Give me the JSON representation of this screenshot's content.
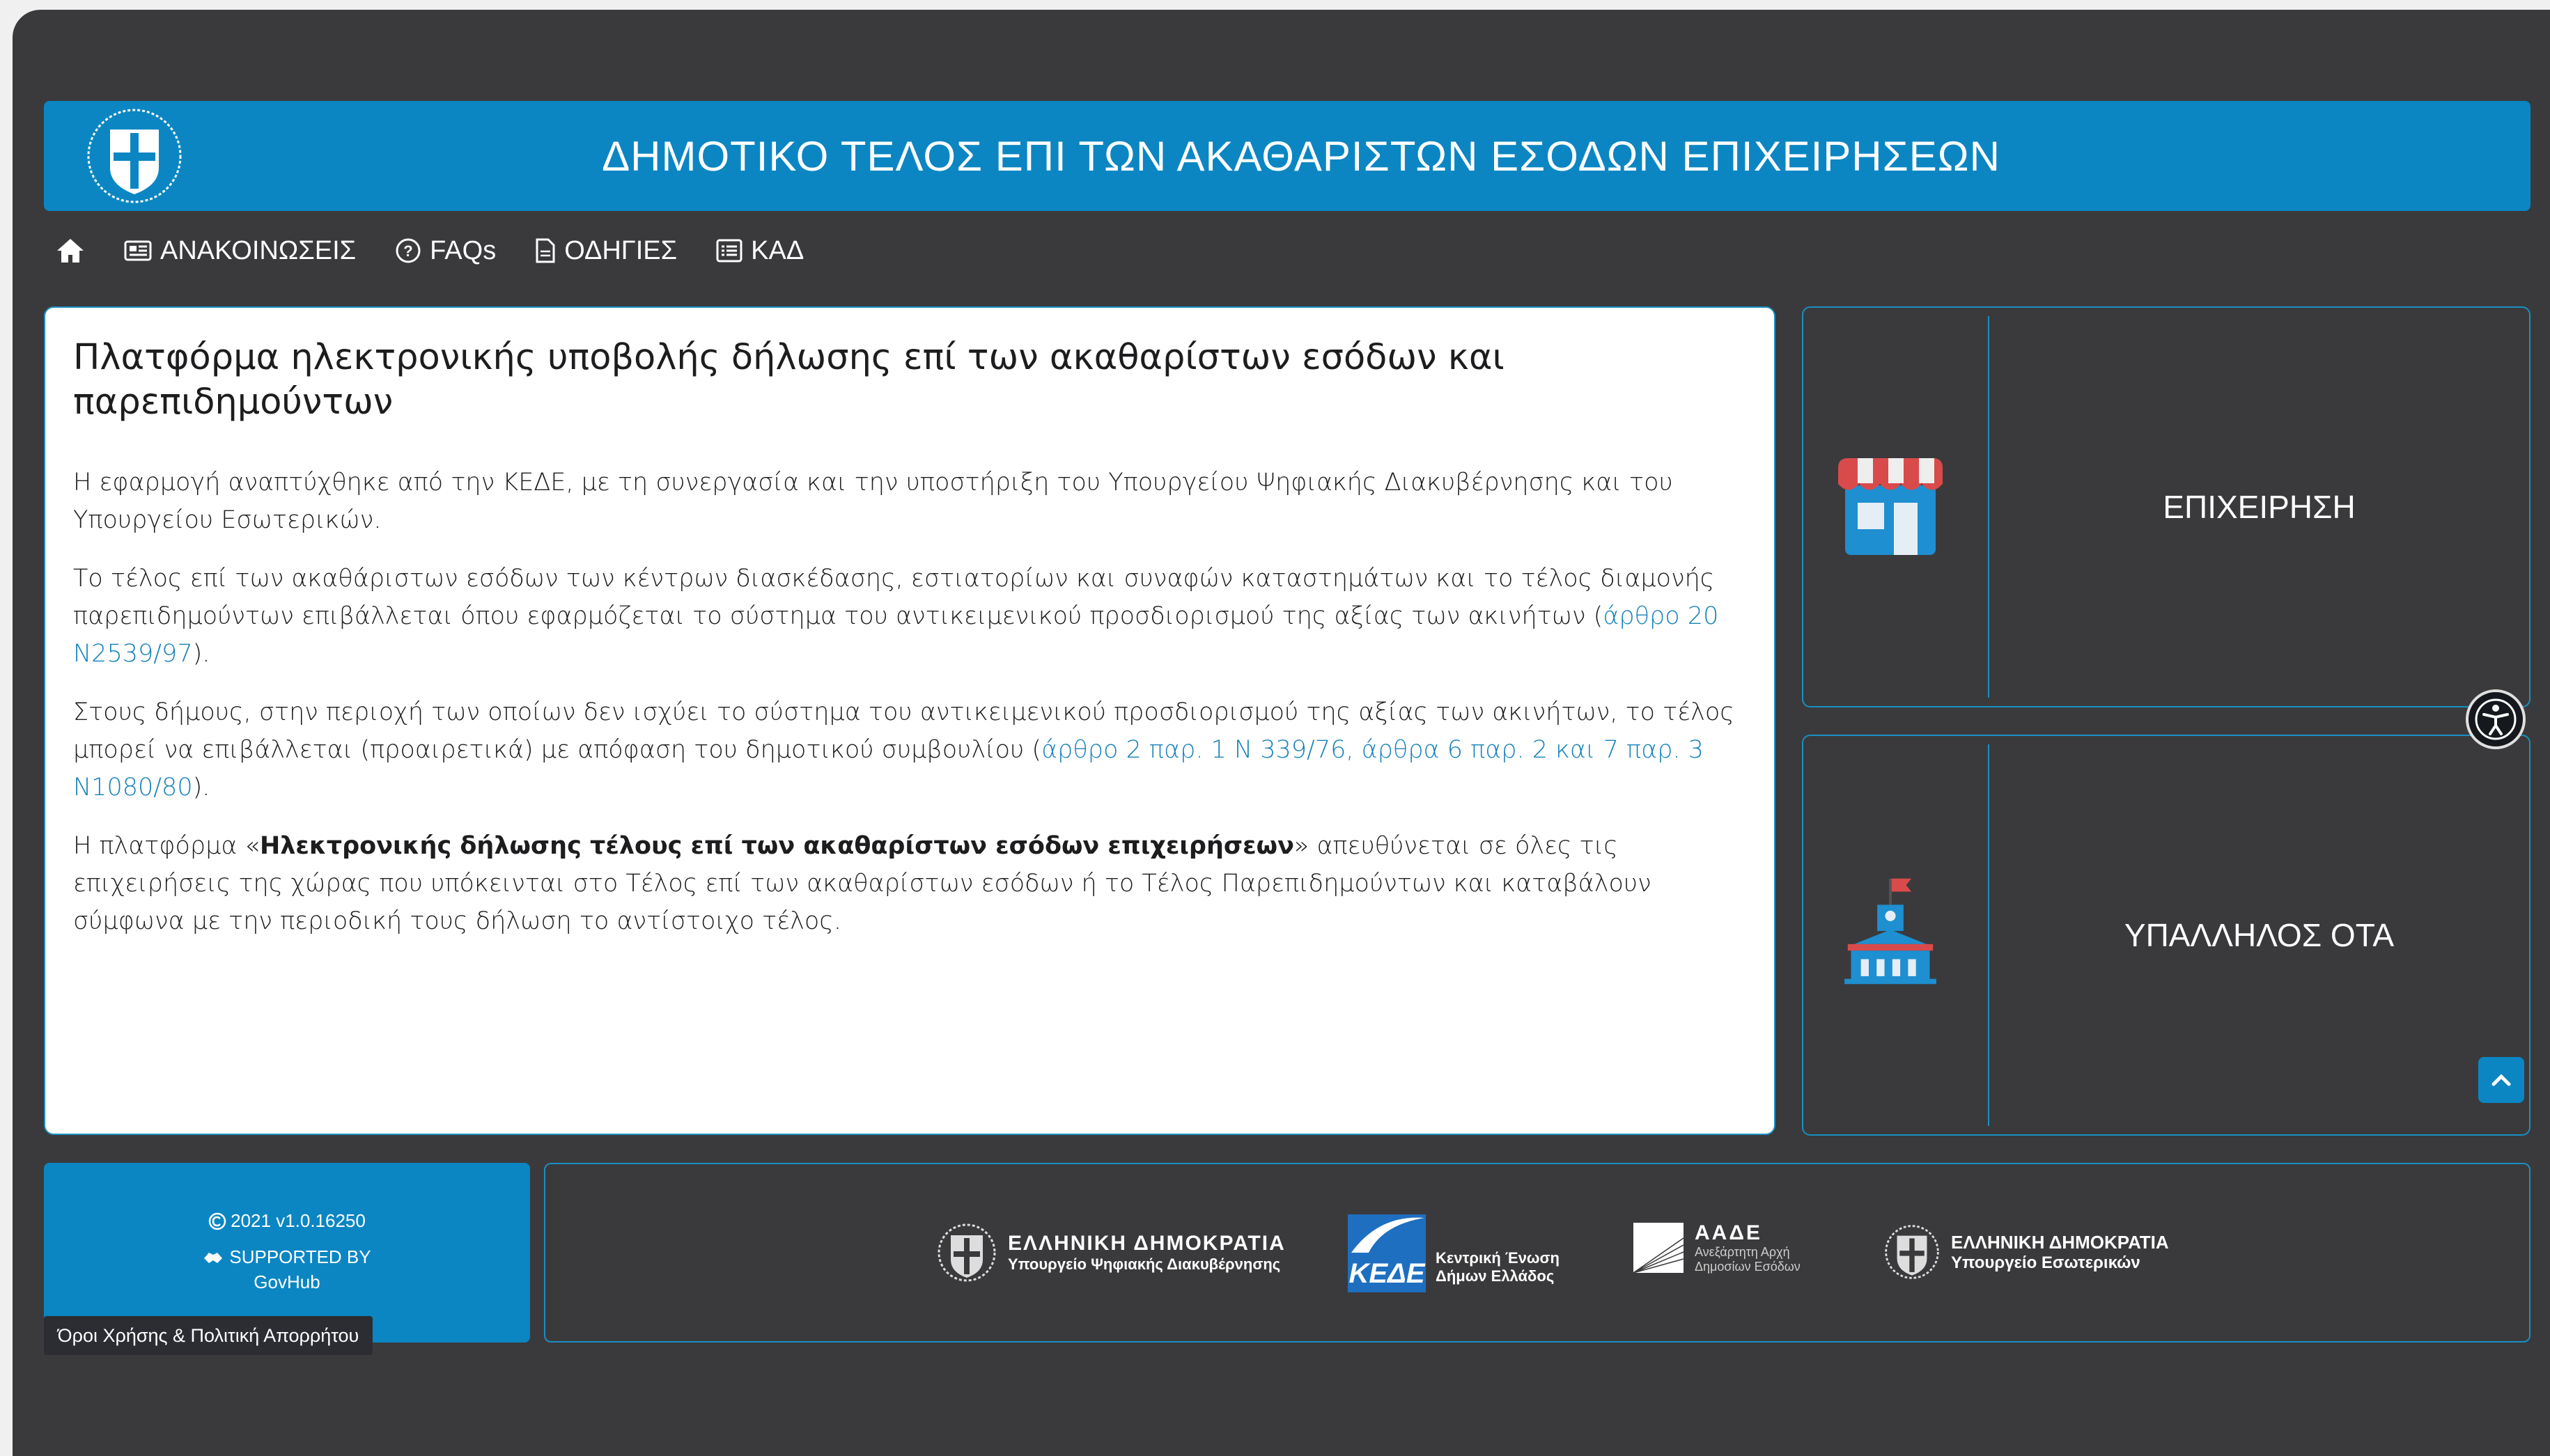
{
  "header": {
    "title": "ΔΗΜΟΤΙΚΟ ΤΕΛΟΣ ΕΠΙ ΤΩΝ ΑΚΑΘΑΡΙΣΤΩΝ ΕΣΟΔΩΝ ΕΠΙΧΕΙΡΗΣΕΩΝ"
  },
  "nav": {
    "announcements": "ΑΝΑΚΟΙΝΩΣΕΙΣ",
    "faqs": "FAQs",
    "instructions": "ΟΔΗΓΙΕΣ",
    "kad": "ΚΑΔ"
  },
  "main": {
    "heading": "Πλατφόρμα ηλεκτρονικής υποβολής δήλωσης επί των ακαθαρίστων εσόδων και παρεπιδημούντων",
    "p1": "Η εφαρμογή αναπτύχθηκε από την ΚΕΔΕ, με τη συνεργασία και την υποστήριξη του Υπουργείου Ψηφιακής Διακυβέρνησης και του Υπουργείου Εσωτερικών.",
    "p2_text": "Το τέλος επί των ακαθάριστων εσόδων των κέντρων διασκέδασης, εστιατορίων και συναφών καταστημάτων και το τέλος διαμονής παρεπιδημούντων επιβάλλεται όπου εφαρμόζεται το σύστημα του αντικειμενικού προσδιορισμού της αξίας των ακινήτων (",
    "p2_link": "άρθρο 20 Ν2539/97",
    "p2_end": ").",
    "p3_text": "Στους δήμους, στην περιοχή των οποίων δεν ισχύει το σύστημα του αντικειμενικού προσδιορισμού της αξίας των ακινήτων, το τέλος μπορεί να επιβάλλεται (προαιρετικά) με απόφαση του δημοτικού συμβουλίου (",
    "p3_link": "άρθρο 2 παρ. 1 Ν 339/76, άρθρα 6 παρ. 2 και 7 παρ. 3 Ν1080/80",
    "p3_end": ").",
    "p4_start": "Η πλατφόρμα «",
    "p4_bold": "Ηλεκτρονικής δήλωσης τέλους επί των ακαθαρίστων εσόδων επιχειρήσεων",
    "p4_end": "» απευθύνεται σε όλες τις επιχειρήσεις της χώρας που υπόκεινται στο Τέλος επί των ακαθαρίστων εσόδων ή το Τέλος Παρεπιδημούντων και καταβάλουν σύμφωνα με την περιοδική τους δήλωση το αντίστοιχο τέλος."
  },
  "roles": {
    "business": "ΕΠΙΧΕΙΡΗΣΗ",
    "employee": "ΥΠΑΛΛΗΛΟΣ ΟΤΑ"
  },
  "footer": {
    "version": "2021 v1.0.16250",
    "supported_by": "SUPPORTED BY",
    "govhub": "GovHub",
    "terms": "Όροι Χρήσης & Πολιτική Απορρήτου",
    "logo1_line1": "ΕΛΛΗΝΙΚΗ ΔΗΜΟΚΡΑΤΙΑ",
    "logo1_line2": "Υπουργείο Ψηφιακής Διακυβέρνησης",
    "logo2_mark": "ΚΕΔΕ",
    "logo2_line1": "Κεντρική Ένωση",
    "logo2_line2": "Δήμων Ελλάδος",
    "logo3_mark": "ΑΑΔΕ",
    "logo3_line1": "Ανεξάρτητη Αρχή",
    "logo3_line2": "Δημοσίων Εσόδων",
    "logo4_line1": "ΕΛΛΗΝΙΚΗ ΔΗΜΟΚΡΑΤΙΑ",
    "logo4_line2": "Υπουργείο Εσωτερικών"
  },
  "colors": {
    "brand": "#0b86c3",
    "background": "#3a3a3c",
    "link": "#1681b8"
  }
}
